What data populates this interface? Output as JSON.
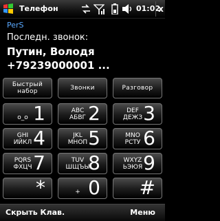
{
  "status": {
    "title": "Телефон",
    "time": "01:02",
    "close": "x",
    "icons": [
      "windows-start-icon",
      "sync-arrows-icon",
      "signal-icon",
      "battery-icon",
      "volume-icon"
    ]
  },
  "info": {
    "name": "PerS",
    "last_call_label": "Последн. звонок:",
    "caller": "Путин, Володя",
    "number": "+79239000001 ..."
  },
  "functions": {
    "speed_dial_1": "Быстрый",
    "speed_dial_2": "набор",
    "calls": "Звонки",
    "talk": "Разговор"
  },
  "keys": [
    {
      "l1": "",
      "l2": "o_o",
      "digit": "1"
    },
    {
      "l1": "ABC",
      "l2": "АБВГ",
      "digit": "2"
    },
    {
      "l1": "DEF",
      "l2": "ДЕЖЗ",
      "digit": "3"
    },
    {
      "l1": "GHI",
      "l2": "ИЙКЛ",
      "digit": "4"
    },
    {
      "l1": "JKL",
      "l2": "МНОП",
      "digit": "5"
    },
    {
      "l1": "MNO",
      "l2": "РСТУ",
      "digit": "6"
    },
    {
      "l1": "PQRS",
      "l2": "ФХЦЧ",
      "digit": "7"
    },
    {
      "l1": "TUV",
      "l2": "ШЩЪЫ",
      "digit": "8"
    },
    {
      "l1": "WXYZ",
      "l2": "ЬЭЮЯ",
      "digit": "9"
    },
    {
      "l1": "",
      "l2": "",
      "digit": "*"
    },
    {
      "l1": "",
      "l2": "+",
      "digit": "0"
    },
    {
      "l1": "",
      "l2": "",
      "digit": "#"
    }
  ],
  "softkeys": {
    "left": "Скрыть Клав.",
    "right": "Меню"
  }
}
